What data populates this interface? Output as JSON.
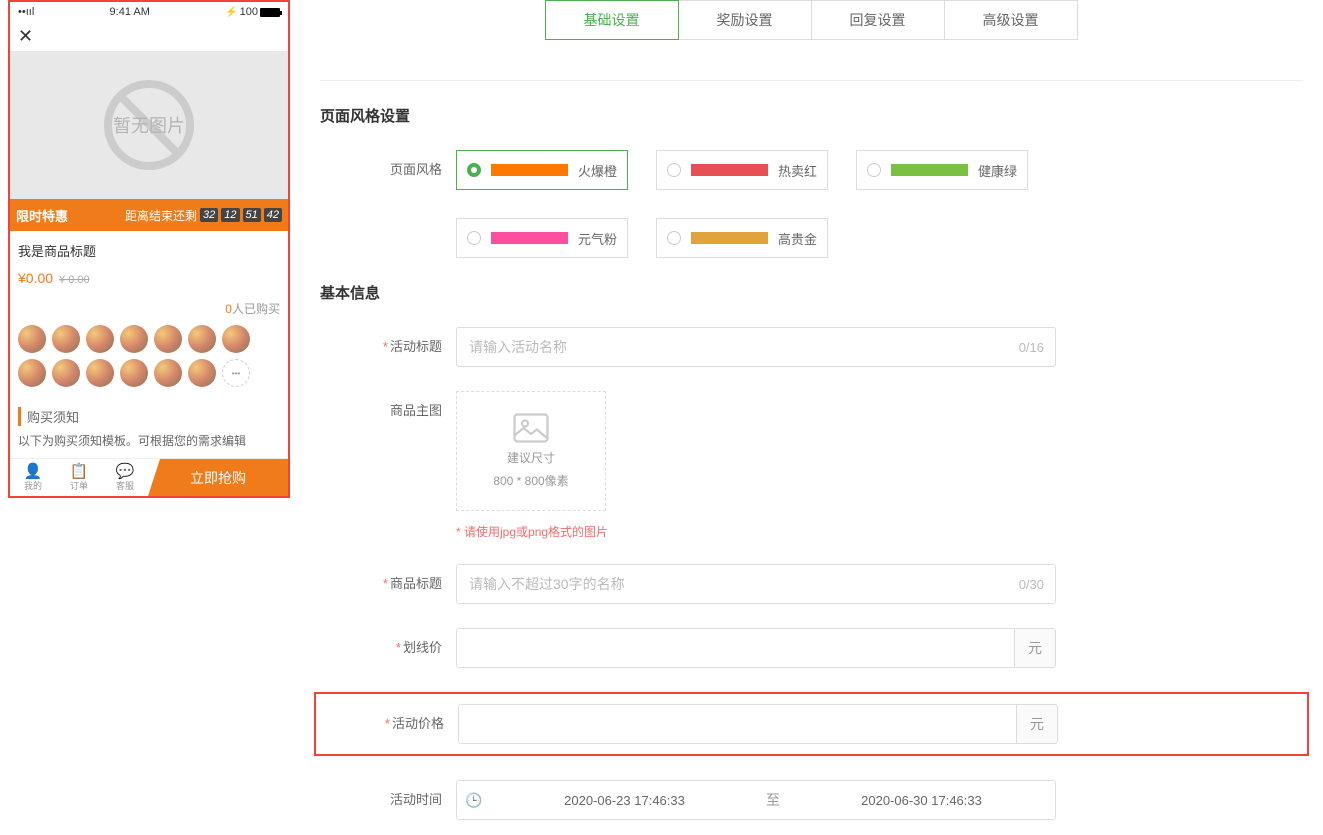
{
  "phone": {
    "statusbar": {
      "time": "9:41 AM",
      "battery": "100"
    },
    "noImage": "暂无图片",
    "promoTag": "限时特惠",
    "countdownLabel": "距离结束还剩",
    "countdown": {
      "d": "32",
      "h": "12",
      "m": "51",
      "s": "42"
    },
    "productTitle": "我是商品标题",
    "priceNow": "¥0.00",
    "priceOld": "¥ 0.00",
    "buyCountNum": "0",
    "buyCountText": "人已购买",
    "noticeHead": "购买须知",
    "noticeBody": "以下为购买须知模板。可根据您的需求编辑",
    "bb": {
      "mine": "我的",
      "order": "订单",
      "service": "客服",
      "buy": "立即抢购"
    }
  },
  "tabs": [
    "基础设置",
    "奖励设置",
    "回复设置",
    "高级设置"
  ],
  "sections": {
    "style": {
      "title": "页面风格设置",
      "label": "页面风格",
      "opts": [
        {
          "name": "火爆橙"
        },
        {
          "name": "热卖红"
        },
        {
          "name": "健康绿"
        },
        {
          "name": "元气粉"
        },
        {
          "name": "高贵金"
        }
      ]
    },
    "basic": {
      "title": "基本信息",
      "activityTitle": {
        "label": "活动标题",
        "placeholder": "请输入活动名称",
        "counter": "0/16"
      },
      "mainImage": {
        "label": "商品主图",
        "line1": "建议尺寸",
        "line2": "800 * 800像素",
        "hint": "请使用jpg或png格式的图片"
      },
      "productTitle": {
        "label": "商品标题",
        "placeholder": "请输入不超过30字的名称",
        "counter": "0/30"
      },
      "linePrice": {
        "label": "划线价",
        "unit": "元"
      },
      "activityPrice": {
        "label": "活动价格",
        "unit": "元"
      },
      "activityTime": {
        "label": "活动时间",
        "start": "2020-06-23 17:46:33",
        "sep": "至",
        "end": "2020-06-30 17:46:33"
      }
    }
  }
}
